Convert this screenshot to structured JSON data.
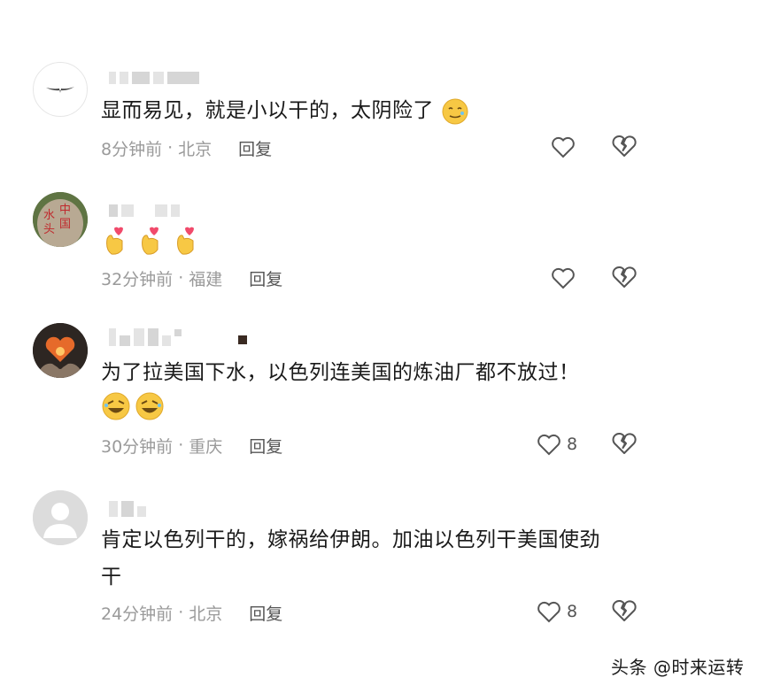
{
  "comments": [
    {
      "text": "显而易见，就是小以干的，太阴险了",
      "emoji": "🥲",
      "time": "8分钟前",
      "location": "北京",
      "reply_label": "回复",
      "likes": ""
    },
    {
      "text": "",
      "emoji": "🫰🫰🫰",
      "time": "32分钟前",
      "location": "福建",
      "reply_label": "回复",
      "likes": "",
      "avatar_text": [
        "中",
        "国",
        "水",
        "头"
      ]
    },
    {
      "text": "为了拉美国下水，以色列连美国的炼油厂都不放过！",
      "emoji": "😆😆",
      "time": "30分钟前",
      "location": "重庆",
      "reply_label": "回复",
      "likes": "8"
    },
    {
      "text_line1": "肯定以色列干的，嫁祸给伊朗。加油以色列干美国使劲",
      "text_line2": "干",
      "time": "24分钟前",
      "location": "北京",
      "reply_label": "回复",
      "likes": "8"
    }
  ],
  "meta_separator": "·",
  "watermark": "头条 @时来运转",
  "colors": {
    "meta_gray": "#9a9a9a",
    "icon_gray": "#555555",
    "emoji_yellow": "#f7c844"
  },
  "icons": [
    "heart-outline-icon",
    "broken-heart-icon",
    "hand-heart-emoji",
    "smile-emoji"
  ]
}
